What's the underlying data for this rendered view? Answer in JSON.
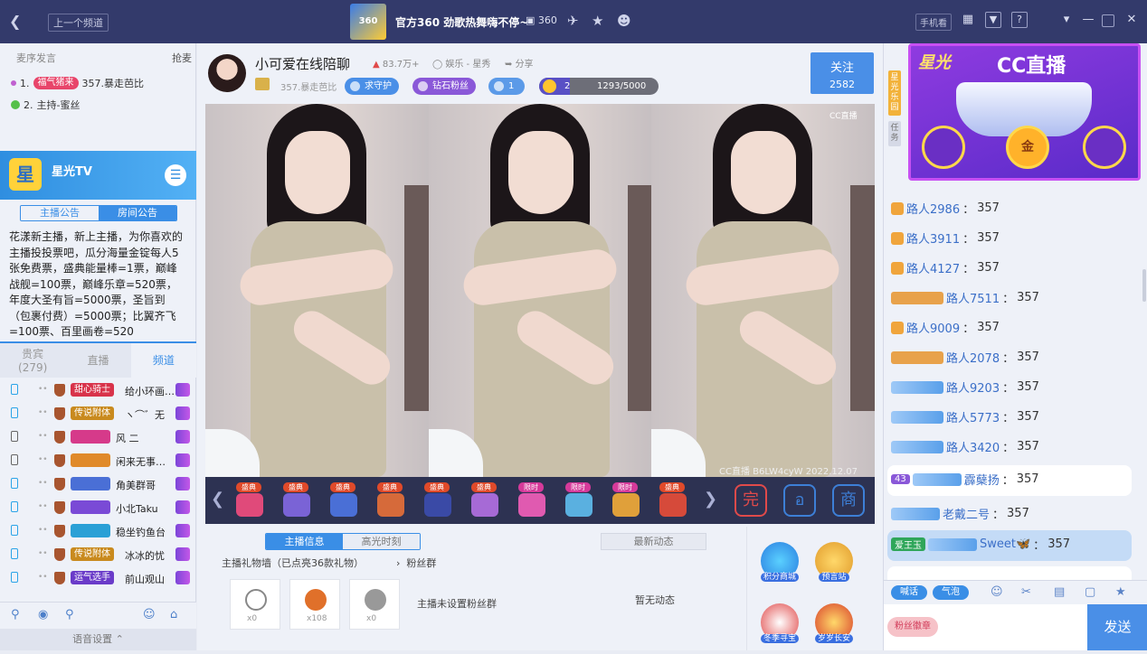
{
  "topbar": {
    "back_icon": "back-arrow-icon",
    "prev_channel": "上一个频道",
    "channel_title": "官方360 劲歌热舞嗨不停~",
    "channel_logo_text": "360",
    "channel_id": "360",
    "phone": "手机看"
  },
  "queue": {
    "title": "麦序发言",
    "grab": "抢麦",
    "rows": [
      {
        "index": "1.",
        "tag": "福气猪来",
        "name": "357.暴走芭比"
      },
      {
        "index": "2.",
        "name": "主持-蜜丝"
      }
    ]
  },
  "star_tv": {
    "logo": "星",
    "name": "星光TV"
  },
  "announce": {
    "tabs": [
      "主播公告",
      "房间公告"
    ],
    "text": "花漾新主播，新上主播，为你喜欢的主播投投票吧，瓜分海量金锭每人5张免费票，盛典能量棒=1票，巅峰战舰=100票，巅峰乐章=520票，年度大圣有旨=5000票，圣旨到（包裹付费）=5000票；比翼齐飞=100票、百里画卷=520"
  },
  "left_tabs": [
    {
      "label": "贵宾",
      "count": "(279)"
    },
    {
      "label": "直播"
    },
    {
      "label": "频道"
    }
  ],
  "viewers": [
    {
      "badge": "甜心骑士",
      "badge_color": "#d8334a",
      "text": "给小环画…"
    },
    {
      "badge": "传说附体",
      "badge_color": "#c98a1e",
      "text": "ヽ⌒゛无"
    },
    {
      "badge": "",
      "text": "风  二"
    },
    {
      "badge": "",
      "text": "闲来无事…"
    },
    {
      "badge": "",
      "text": "角美群哥"
    },
    {
      "badge": "",
      "text": "小北Taku"
    },
    {
      "badge": "",
      "text": "稳坐钓鱼台"
    },
    {
      "badge": "传说附体",
      "badge_color": "#c98a1e",
      "text": "冰冰的忧"
    },
    {
      "badge": "运气选手",
      "badge_color": "#6a3bc9",
      "text": "前山观山"
    }
  ],
  "voice_settings": "语音设置",
  "anchor": {
    "name": "小可爱在线陪聊",
    "popularity": "83.7万+",
    "category": "娱乐 - 星秀",
    "share": "分享",
    "owner": "357.暴走芭比",
    "guard_btn": "求守护",
    "fans_btn": "钻石粉丝",
    "fans_count": "1",
    "level": "2",
    "level_progress": "1293/5000",
    "level_fraction": 0.2586,
    "follow": "关注",
    "follow_count": "2582"
  },
  "video": {
    "watermark": "CC直播",
    "caption": "CC直播  B6LW4cyW  2022.12.07"
  },
  "gifts": [
    {
      "tag": "盛典",
      "color": "#e04a7a"
    },
    {
      "tag": "盛典",
      "color": "#7a63d6"
    },
    {
      "tag": "盛典",
      "color": "#4a6fd6"
    },
    {
      "tag": "盛典",
      "color": "#d66a3a"
    },
    {
      "tag": "盛典",
      "color": "#3a4aa6"
    },
    {
      "tag": "盛典",
      "color": "#a66ad6"
    },
    {
      "tag": "限时",
      "color": "#e05ab0"
    },
    {
      "tag": "限时",
      "color": "#5ab0e0"
    },
    {
      "tag": "限时",
      "color": "#e0a03a"
    },
    {
      "tag": "盛典",
      "color": "#d64a3a"
    }
  ],
  "big_icons": [
    "完",
    "อ",
    "商"
  ],
  "sub_tabs": [
    "主播信息",
    "高光时刻"
  ],
  "news_btn": "最新动态",
  "gift_wall": "主播礼物墙（已点亮36款礼物）",
  "fans_group": "粉丝群",
  "gift_wall_items": [
    {
      "count": "x0"
    },
    {
      "count": "x108"
    },
    {
      "count": "x0"
    }
  ],
  "no_fans_group": "主播未设置粉丝群",
  "no_news": "暂无动态",
  "side_buttons": [
    "积分商城",
    "预言站",
    "冬季寻宝",
    "岁岁长安"
  ],
  "right_vtabs": [
    "星光乐园",
    "任务"
  ],
  "promo": {
    "title": "星光",
    "brand": "CC直播",
    "coin": "金"
  },
  "chat": [
    {
      "name": "路人2986",
      "value": "357"
    },
    {
      "name": "路人3911",
      "value": "357"
    },
    {
      "name": "路人4127",
      "value": "357"
    },
    {
      "name": "路人7511",
      "value": "357"
    },
    {
      "name": "路人9009",
      "value": "357"
    },
    {
      "name": "路人2078",
      "value": "357"
    },
    {
      "name": "路人9203",
      "value": "357"
    },
    {
      "name": "路人5773",
      "value": "357"
    },
    {
      "name": "路人3420",
      "value": "357"
    },
    {
      "name": "霹蘖扬",
      "value": "357",
      "level": "43"
    },
    {
      "name": "老戴二号",
      "value": "357"
    },
    {
      "name": "Sweet🦋",
      "value": "357",
      "tag": "爱王玉"
    }
  ],
  "chat_buttons": [
    "喊话",
    "气泡"
  ],
  "input_tag": "粉丝徽章",
  "send": "发送"
}
